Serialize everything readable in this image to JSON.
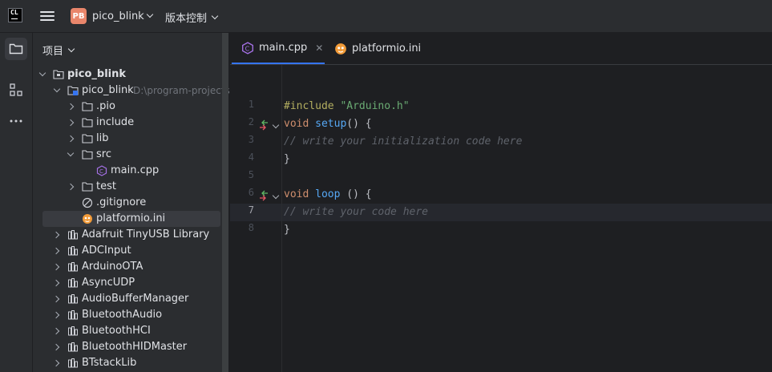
{
  "titlebar": {
    "logo_text": "CL",
    "project_badge": "PB",
    "project_name": "pico_blink",
    "vcs_label": "版本控制"
  },
  "project_panel": {
    "title": "项目",
    "tree": [
      {
        "label": "pico_blink",
        "bold": true
      },
      {
        "label": "pico_blink",
        "extra": "D:\\program-projects"
      },
      {
        "label": ".pio"
      },
      {
        "label": "include"
      },
      {
        "label": "lib"
      },
      {
        "label": "src"
      },
      {
        "label": "main.cpp"
      },
      {
        "label": "test"
      },
      {
        "label": ".gitignore"
      },
      {
        "label": "platformio.ini"
      },
      {
        "label": "Adafruit TinyUSB Library"
      },
      {
        "label": "ADCInput"
      },
      {
        "label": "ArduinoOTA"
      },
      {
        "label": "AsyncUDP"
      },
      {
        "label": "AudioBufferManager"
      },
      {
        "label": "BluetoothAudio"
      },
      {
        "label": "BluetoothHCI"
      },
      {
        "label": "BluetoothHIDMaster"
      },
      {
        "label": "BTstackLib"
      }
    ]
  },
  "tabs": [
    {
      "label": "main.cpp",
      "active": true
    },
    {
      "label": "platformio.ini",
      "active": false
    }
  ],
  "editor": {
    "line_numbers": [
      "1",
      "2",
      "3",
      "4",
      "5",
      "6",
      "7",
      "8"
    ],
    "current_line": 7,
    "lines": {
      "l1_directive": "#include",
      "l1_string": "\"Arduino.h\"",
      "l2_kw": "void",
      "l2_fn": "setup",
      "l2_rest": "() {",
      "l3_comment": "// write your initialization code here",
      "l4": "}",
      "l6_kw": "void",
      "l6_fn": "loop",
      "l6_rest": "() {",
      "l7_comment": "// write your code here",
      "l8": "}"
    }
  },
  "colors": {
    "accent": "#3574f0",
    "badge": "#e9866b",
    "keyword": "#cf8e6d",
    "string": "#6aab73",
    "function": "#56a8f5",
    "comment": "#5f636b"
  },
  "icons": {
    "logo": "clion-logo-icon",
    "menu": "hamburger-menu-icon",
    "project": "folder-icon",
    "structure": "structure-icon",
    "more": "more-dots-icon",
    "cpp_file": "cpp-file-icon",
    "ini_file": "platformio-icon",
    "library": "library-icon",
    "gitignore": "ignore-file-icon",
    "close": "close-icon",
    "fold": "fold-arrow-icon",
    "navigate": "navigate-to-declaration-icon"
  }
}
